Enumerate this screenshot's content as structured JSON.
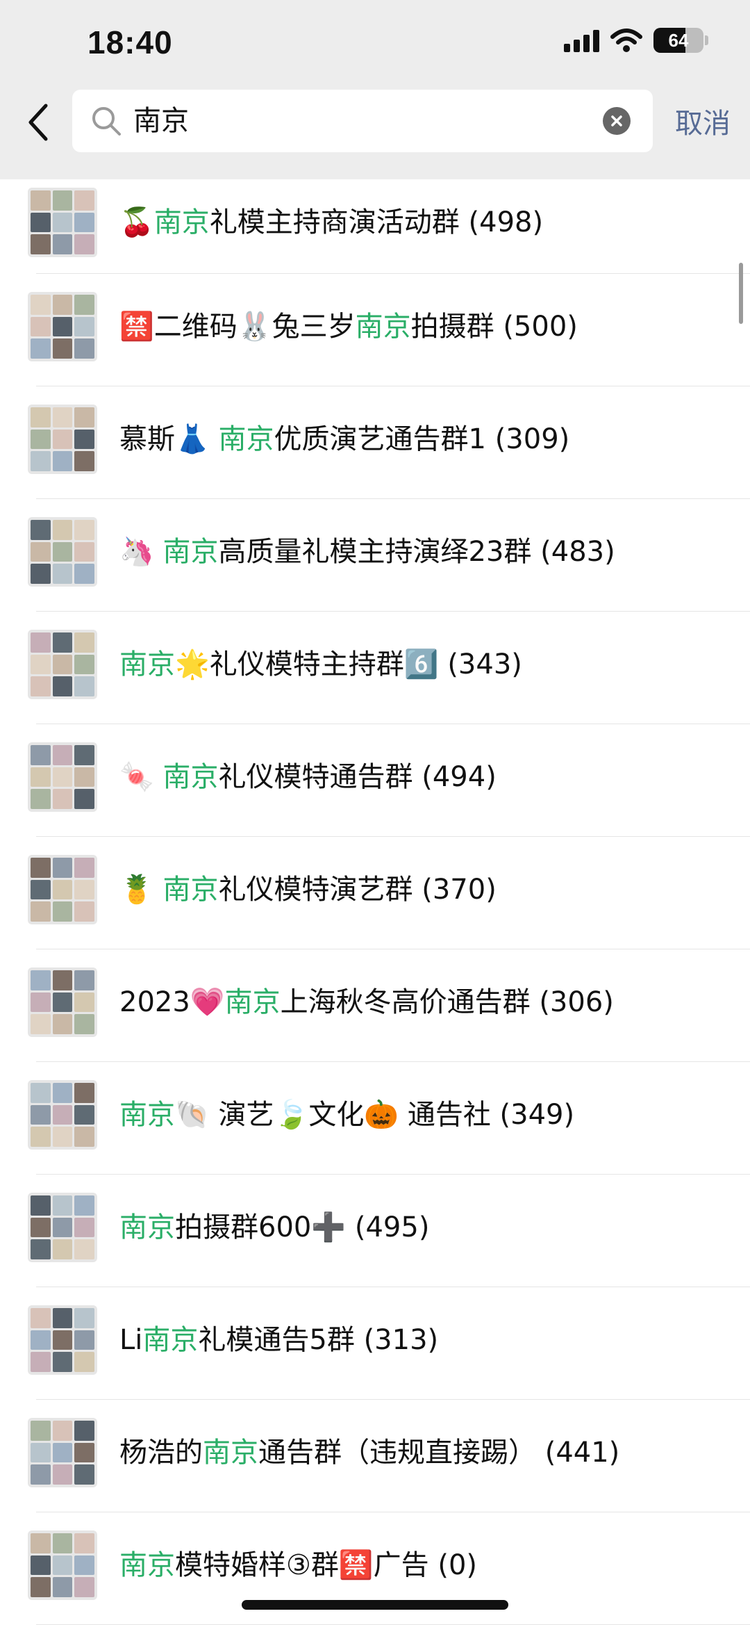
{
  "status_bar": {
    "time": "18:40",
    "battery": "64"
  },
  "search": {
    "query": "南京"
  },
  "header": {
    "cancel_label": "取消"
  },
  "results": [
    {
      "parts": [
        {
          "t": "🍒",
          "h": false
        },
        {
          "t": "南京",
          "h": true
        },
        {
          "t": "礼模主持商演活动群 (498)",
          "h": false
        }
      ]
    },
    {
      "parts": [
        {
          "t": "🈲二维码🐰兔三岁",
          "h": false
        },
        {
          "t": "南京",
          "h": true
        },
        {
          "t": "拍摄群 (500)",
          "h": false
        }
      ]
    },
    {
      "parts": [
        {
          "t": "慕斯👗 ",
          "h": false
        },
        {
          "t": "南京",
          "h": true
        },
        {
          "t": "优质演艺通告群1 (309)",
          "h": false
        }
      ]
    },
    {
      "parts": [
        {
          "t": "🦄 ",
          "h": false
        },
        {
          "t": "南京",
          "h": true
        },
        {
          "t": "高质量礼模主持演绎23群 (483)",
          "h": false
        }
      ]
    },
    {
      "parts": [
        {
          "t": "南京",
          "h": true
        },
        {
          "t": "🌟礼仪模特主持群6️⃣ (343)",
          "h": false
        }
      ]
    },
    {
      "parts": [
        {
          "t": "🍬 ",
          "h": false
        },
        {
          "t": "南京",
          "h": true
        },
        {
          "t": "礼仪模特通告群 (494)",
          "h": false
        }
      ]
    },
    {
      "parts": [
        {
          "t": "🍍 ",
          "h": false
        },
        {
          "t": "南京",
          "h": true
        },
        {
          "t": "礼仪模特演艺群 (370)",
          "h": false
        }
      ]
    },
    {
      "parts": [
        {
          "t": "2023💗",
          "h": false
        },
        {
          "t": "南京",
          "h": true
        },
        {
          "t": "上海秋冬高价通告群 (306)",
          "h": false
        }
      ]
    },
    {
      "parts": [
        {
          "t": "南京",
          "h": true
        },
        {
          "t": "🐚 演艺🍃文化🎃 通告社 (349)",
          "h": false
        }
      ]
    },
    {
      "parts": [
        {
          "t": "南京",
          "h": true
        },
        {
          "t": "拍摄群600➕ (495)",
          "h": false
        }
      ]
    },
    {
      "parts": [
        {
          "t": "Li",
          "h": false
        },
        {
          "t": "南京",
          "h": true
        },
        {
          "t": "礼模通告5群 (313)",
          "h": false
        }
      ]
    },
    {
      "parts": [
        {
          "t": "杨浩的",
          "h": false
        },
        {
          "t": "南京",
          "h": true
        },
        {
          "t": "通告群（违规直接踢） (441)",
          "h": false
        }
      ]
    },
    {
      "parts": [
        {
          "t": "南京",
          "h": true
        },
        {
          "t": "模特婚样③群🈲广告 (0)",
          "h": false
        }
      ]
    }
  ],
  "colors": {
    "highlight": "#2aae67",
    "link": "#576b95",
    "topbar": "#ededed"
  }
}
